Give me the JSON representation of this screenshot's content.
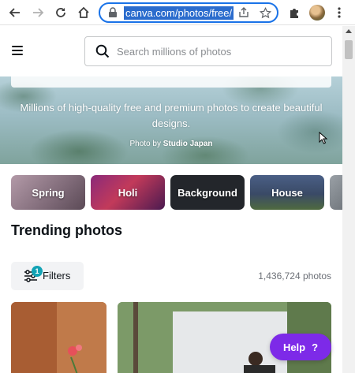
{
  "browser": {
    "url": "canva.com/photos/free/",
    "icons": {
      "back": "back-arrow-icon",
      "forward": "forward-arrow-icon",
      "reload": "reload-icon",
      "home": "home-icon",
      "lock": "lock-icon",
      "share": "share-icon",
      "bookmark": "star-icon",
      "extensions": "puzzle-icon",
      "menu": "kebab-menu-icon"
    }
  },
  "header": {
    "search_placeholder": "Search millions of photos"
  },
  "hero": {
    "text": "Millions of high-quality free and premium photos to create beautiful designs.",
    "credit_prefix": "Photo by",
    "credit_name": "Studio Japan"
  },
  "chips": [
    {
      "label": "Spring",
      "color": "#9a7a8a"
    },
    {
      "label": "Holi",
      "color": "#6a2060"
    },
    {
      "label": "Background",
      "color": "#23262b"
    },
    {
      "label": "House",
      "color": "#3d4d6a"
    },
    {
      "label": "",
      "color": "#7a7f85"
    }
  ],
  "section": {
    "title": "Trending photos"
  },
  "filters": {
    "label": "Filters",
    "badge": "1"
  },
  "results": {
    "count": "1,436,724 photos"
  },
  "help": {
    "label": "Help",
    "icon": "?"
  },
  "colors": {
    "accent": "#7d2ae8",
    "badge": "#13a3b5",
    "omnibox_border": "#1a73e8"
  }
}
